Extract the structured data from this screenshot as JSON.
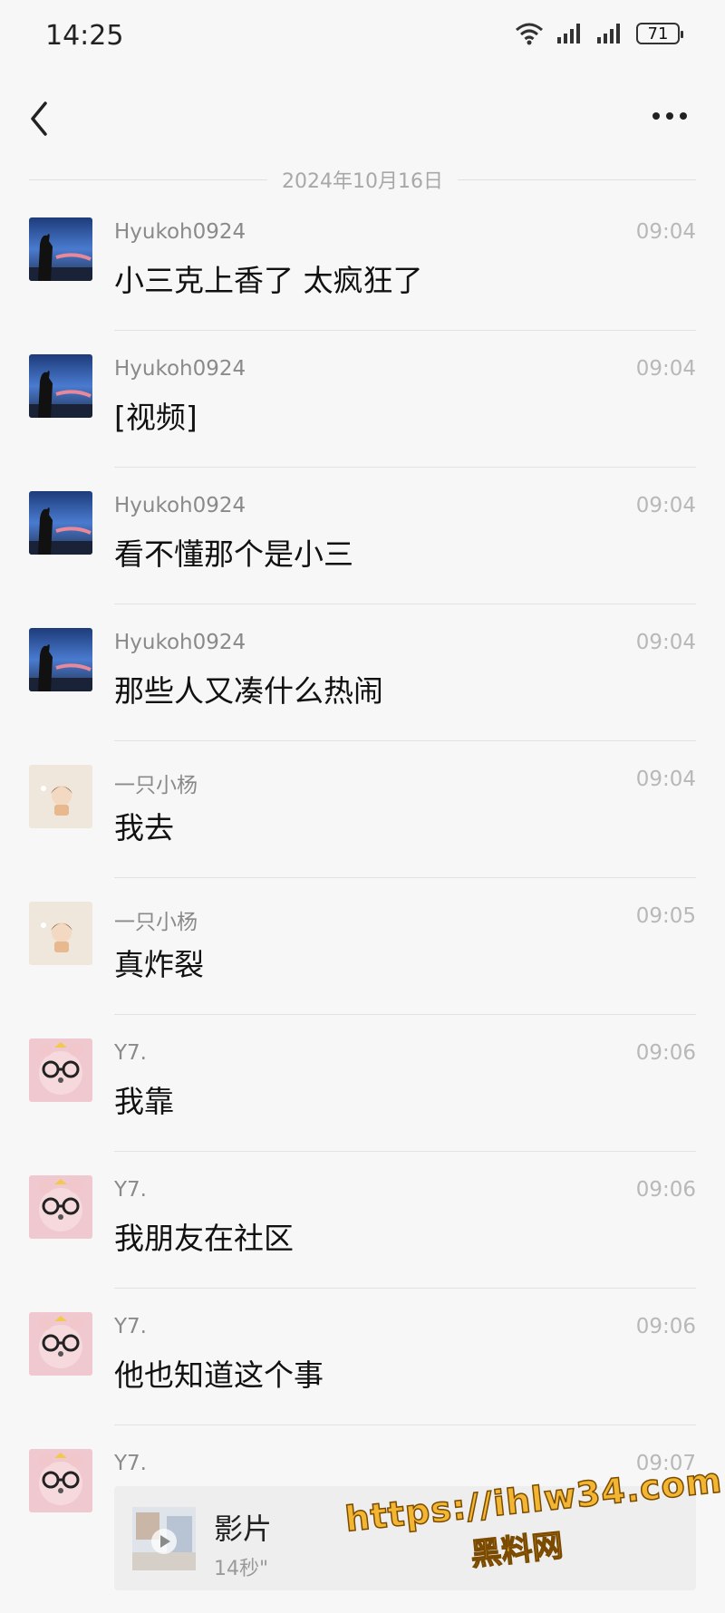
{
  "status_bar": {
    "time": "14:25",
    "battery": "71"
  },
  "header": {
    "date": "2024年10月16日"
  },
  "messages": [
    {
      "sender": "Hyukoh0924",
      "time": "09:04",
      "text": "小三克上香了 太疯狂了"
    },
    {
      "sender": "Hyukoh0924",
      "time": "09:04",
      "text": "[视频]"
    },
    {
      "sender": "Hyukoh0924",
      "time": "09:04",
      "text": "看不懂那个是小三"
    },
    {
      "sender": "Hyukoh0924",
      "time": "09:04",
      "text": "那些人又凑什么热闹"
    },
    {
      "sender": "一只小杨",
      "time": "09:04",
      "text": "我去"
    },
    {
      "sender": "一只小杨",
      "time": "09:05",
      "text": "真炸裂"
    },
    {
      "sender": "Y7.",
      "time": "09:06",
      "text": "我靠"
    },
    {
      "sender": "Y7.",
      "time": "09:06",
      "text": "我朋友在社区"
    },
    {
      "sender": "Y7.",
      "time": "09:06",
      "text": "他也知道这个事"
    },
    {
      "sender": "Y7.",
      "time": "09:07",
      "video": {
        "title": "影片",
        "duration": "14秒\""
      }
    }
  ],
  "watermark": {
    "url": "https://ihlw34.com",
    "name": "黑料网"
  },
  "icons": {
    "back": "chevron-left-icon",
    "more": "more-dots-icon",
    "wifi": "wifi-icon",
    "signal": "signal-bars-icon",
    "play": "play-icon"
  }
}
